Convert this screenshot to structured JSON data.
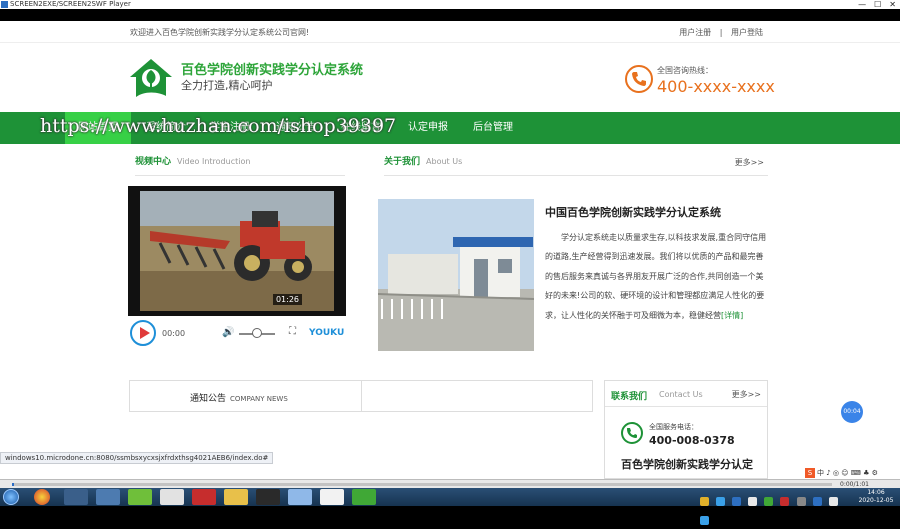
{
  "window": {
    "title": "SCREEN2EXE/SCREEN2SWF Player",
    "minimize_glyph": "—",
    "maximize_glyph": "☐",
    "close_glyph": "✕"
  },
  "site": {
    "welcome_text": "欢迎进入百色学院创新实践学分认定系统公司官网!",
    "top_links": [
      "用户注册",
      "用户登陆"
    ],
    "title": "百色学院创新实践学分认定系统",
    "slogan": "全力打造,精心呵护",
    "hotline_label": "全国咨询热线：",
    "hotline_number": "400-xxxx-xxxx"
  },
  "nav": {
    "items": [
      "网站首页",
      "系统简介",
      "学生注册",
      "通知公告",
      "在线留言",
      "认定申报",
      "后台管理"
    ]
  },
  "watermark": "https://www.huzhan.com/ishop39397",
  "video": {
    "heading_cn": "视频中心",
    "heading_en": "Video Introduction",
    "duration_badge": "01:26",
    "current_time": "00:00",
    "brand": "YOUKU",
    "volume_icon": "🔊",
    "fullscreen_icon": "⛶"
  },
  "about": {
    "heading_cn": "关于我们",
    "heading_en": "About Us",
    "more": "更多>>",
    "title": "中国百色学院创新实践学分认定系统",
    "body": "学分认定系统走以质量求生存,以科技求发展,重合同守信用的道路,生产经营得到迅速发展。我们将以优质的产品和最完善的售后服务来真诚与各界朋友开展广泛的合作,共同创造一个美好的未来!公司的软、硬环境的设计和管理都应满足人性化的要求，让人性化的关怀融于可及细微为本，稳健经营",
    "detail_link": "[详情]"
  },
  "notice": {
    "heading_cn": "通知公告",
    "heading_en": "COMPANY NEWS"
  },
  "contact": {
    "heading_cn": "联系我们",
    "heading_en": "Contact Us",
    "more": "更多>>",
    "service_label": "全国服务电话：",
    "service_number": "400-008-0378",
    "name": "百色学院创新实践学分认定"
  },
  "status_url": "windows10.microdone.cn:8080/ssmbsxycxsjxfrdxthsg4021AEB6/index.do#",
  "timer_badge": "00:04",
  "ime": {
    "logo": "S",
    "text": "中 ♪ ◎ ☺ ⌨ ♣ ⚙"
  },
  "player": {
    "time_text": "0:00/1:01"
  },
  "clock": {
    "time": "14:06",
    "date": "2020-12-05"
  },
  "colors": {
    "brand_green": "#1e9237",
    "active_nav": "#37d046",
    "hotline_orange": "#e8711e"
  }
}
